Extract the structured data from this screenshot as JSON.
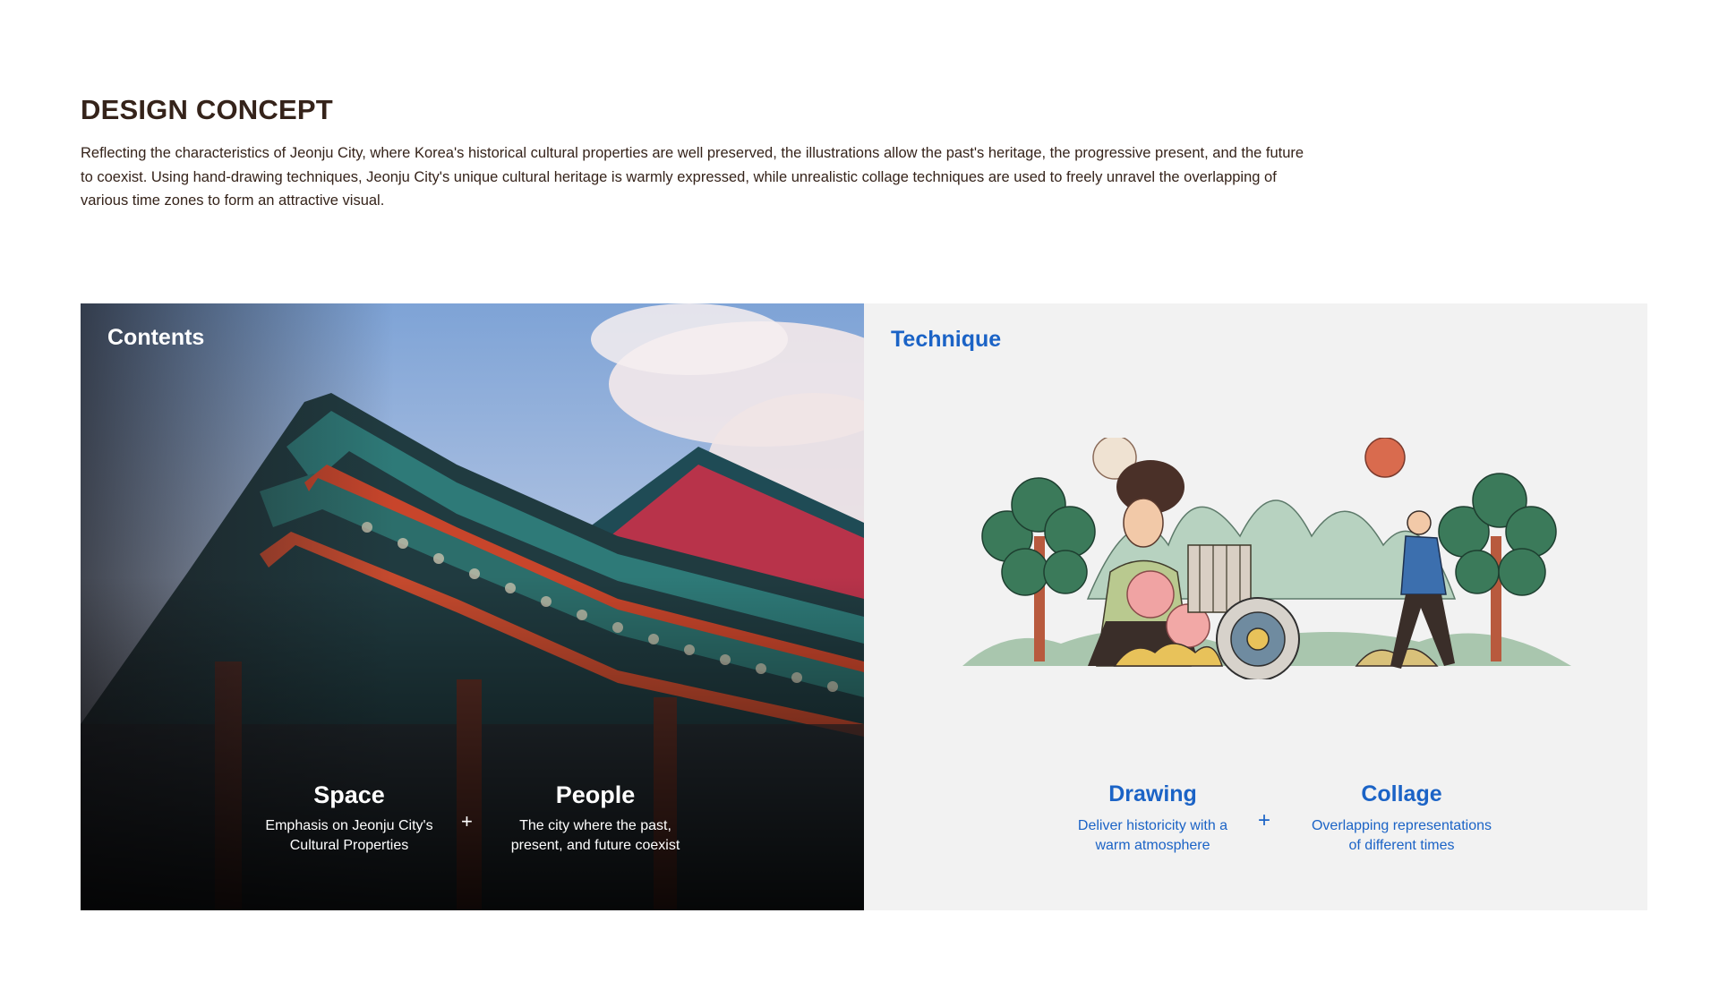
{
  "header": {
    "title": "DESIGN CONCEPT",
    "description": "Reflecting the characteristics of Jeonju City, where Korea's historical cultural properties are well preserved, the illustrations allow the past's heritage, the progressive present, and the future to coexist. Using hand-drawing techniques, Jeonju City's unique cultural heritage is warmly expressed, while unrealistic collage techniques are used to freely unravel the overlapping of various time zones to form an attractive visual."
  },
  "contents": {
    "label": "Contents",
    "plus": "+",
    "items": [
      {
        "title": "Space",
        "subtitle_1": "Emphasis on Jeonju City's",
        "subtitle_2": "Cultural Properties"
      },
      {
        "title": "People",
        "subtitle_1": "The city where the past,",
        "subtitle_2": "present, and future coexist"
      }
    ]
  },
  "technique": {
    "label": "Technique",
    "plus": "+",
    "items": [
      {
        "title": "Drawing",
        "subtitle_1": "Deliver historicity with a",
        "subtitle_2": "warm atmosphere"
      },
      {
        "title": "Collage",
        "subtitle_1": "Overlapping representations",
        "subtitle_2": "of different times"
      }
    ]
  },
  "colors": {
    "title_text": "#35231a",
    "accent_blue": "#1b63c6",
    "panel_gray": "#f2f2f2"
  }
}
